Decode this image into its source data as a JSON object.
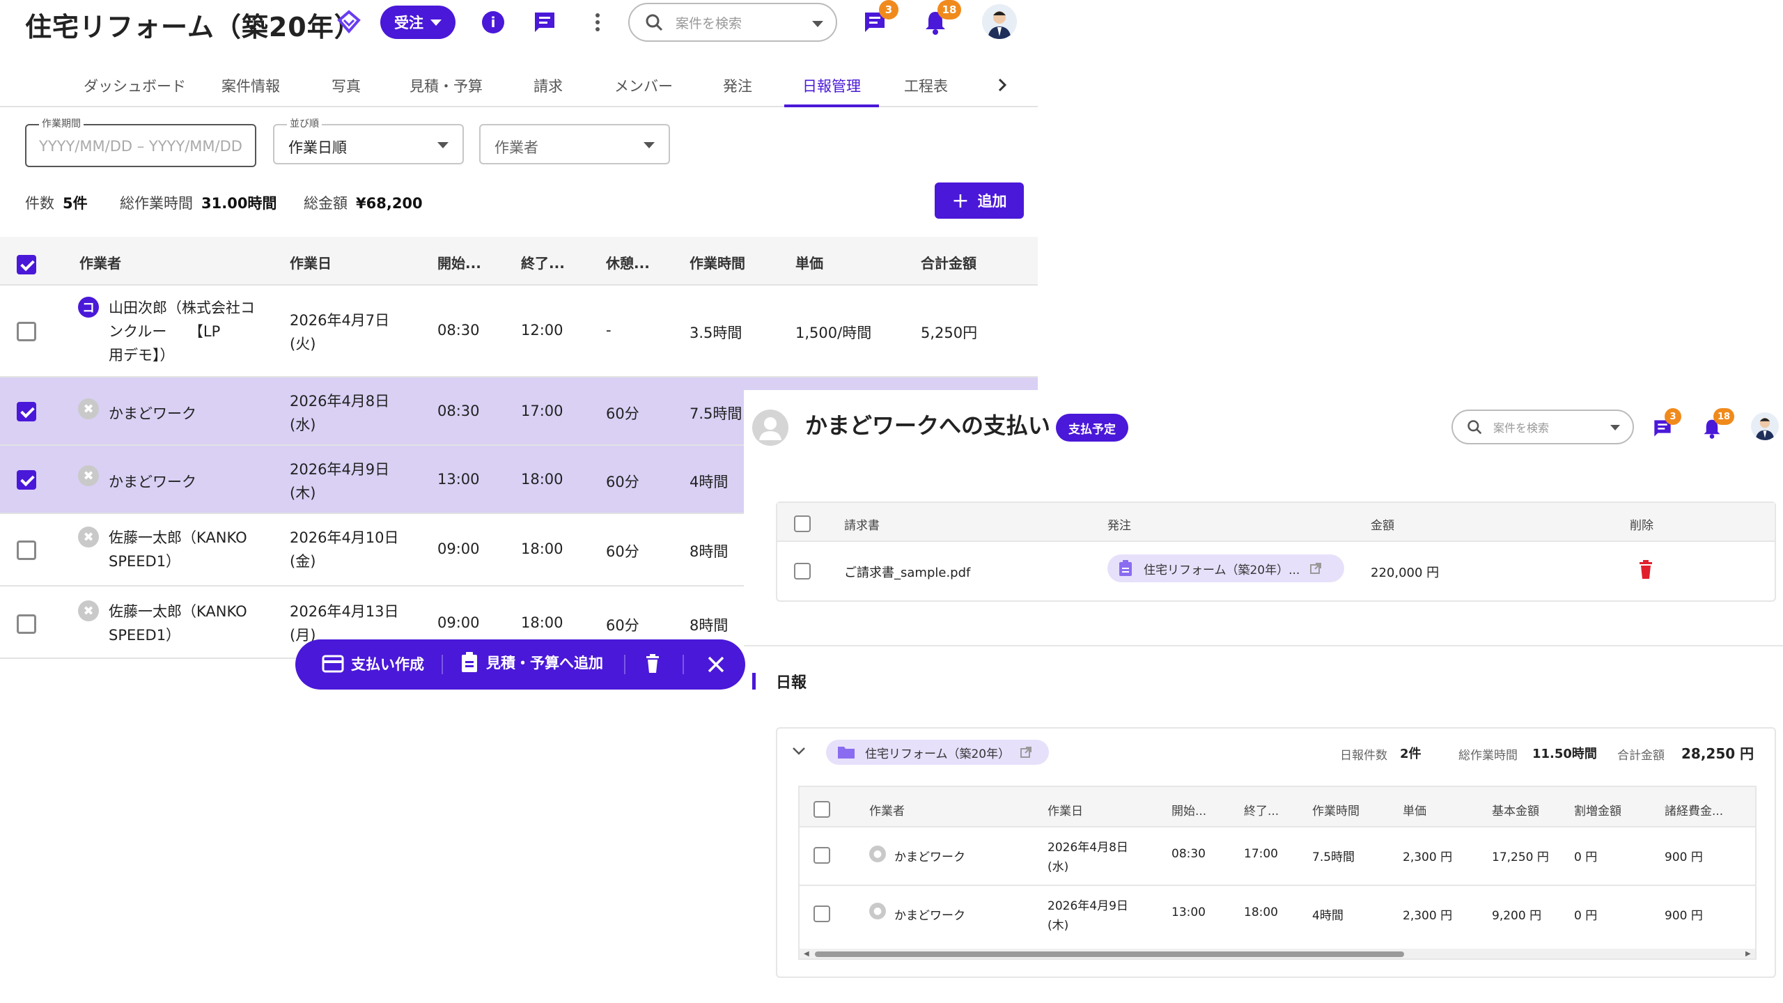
{
  "project": {
    "title": "住宅リフォーム（築20年）",
    "status_label": "受注",
    "search_placeholder": "案件を検索",
    "messages_count": "3",
    "notifications_count": "18"
  },
  "tabs": [
    "ダッシュボード",
    "案件情報",
    "写真",
    "見積・予算",
    "請求",
    "メンバー",
    "発注",
    "日報管理",
    "工程表"
  ],
  "active_tab": "日報管理",
  "filters": {
    "period_label": "作業期間",
    "period_placeholder": "YYYY/MM/DD – YYYY/MM/DD",
    "sort_label": "並び順",
    "sort_value": "作業日順",
    "worker_placeholder": "作業者"
  },
  "summary": {
    "count_label": "件数",
    "count_value": "5件",
    "hours_label": "総作業時間",
    "hours_value": "31.00時間",
    "amount_label": "総金額",
    "amount_value": "¥68,200"
  },
  "add_button": "追加",
  "table": {
    "headers": [
      "作業者",
      "作業日",
      "開始...",
      "終了...",
      "休憩...",
      "作業時間",
      "単価",
      "合計金額"
    ],
    "rows": [
      {
        "worker_line1": "山田次郎（株式会社コ",
        "worker_line2": "ンクルー　　【LP",
        "worker_line3": "用デモ】）",
        "date1": "2026年4月7日",
        "date2": "(火)",
        "start": "08:30",
        "end": "12:00",
        "rest": "-",
        "hours": "3.5時間",
        "rate": "1,500/時間",
        "total": "5,250円",
        "avatar": "コ",
        "selected": false
      },
      {
        "worker_line1": "かまどワーク",
        "worker_line2": "",
        "worker_line3": "",
        "date1": "2026年4月8日",
        "date2": "(水)",
        "start": "08:30",
        "end": "17:00",
        "rest": "60分",
        "hours": "7.5時間",
        "rate": "",
        "total": "",
        "selected": true
      },
      {
        "worker_line1": "かまどワーク",
        "worker_line2": "",
        "worker_line3": "",
        "date1": "2026年4月9日",
        "date2": "(木)",
        "start": "13:00",
        "end": "18:00",
        "rest": "60分",
        "hours": "4時間",
        "rate": "",
        "total": "",
        "selected": true
      },
      {
        "worker_line1": "佐藤一太郎（KANKO",
        "worker_line2": "SPEED1）",
        "worker_line3": "",
        "date1": "2026年4月10日",
        "date2": "(金)",
        "start": "09:00",
        "end": "18:00",
        "rest": "60分",
        "hours": "8時間",
        "rate": "",
        "total": "",
        "selected": false
      },
      {
        "worker_line1": "佐藤一太郎（KANKO",
        "worker_line2": "SPEED1）",
        "worker_line3": "",
        "date1": "2026年4月13日",
        "date2": "(月)",
        "start": "09:00",
        "end": "18:00",
        "rest": "60分",
        "hours": "8時間",
        "rate": "",
        "total": "",
        "selected": false
      }
    ]
  },
  "bulk_bar": {
    "create_payment": "支払い作成",
    "add_to_estimate": "見積・予算へ追加"
  },
  "payment": {
    "title": "かまどワークへの支払い",
    "status": "支払予定",
    "search_placeholder": "案件を検索",
    "messages_count": "3",
    "notifications_count": "18",
    "invoice_headers": [
      "請求書",
      "発注",
      "金額",
      "削除"
    ],
    "invoice_file": "ご請求書_sample.pdf",
    "invoice_order": "住宅リフォーム（築20年）...",
    "invoice_amount": "220,000 円",
    "daily_section": "日報",
    "group_name": "住宅リフォーム（築20年）",
    "group_count_label": "日報件数",
    "group_count": "2件",
    "group_hours_label": "総作業時間",
    "group_hours": "11.50時間",
    "group_total_label": "合計金額",
    "group_total": "28,250 円",
    "daily_headers": [
      "作業者",
      "作業日",
      "開始...",
      "終了...",
      "作業時間",
      "単価",
      "基本金額",
      "割増金額",
      "諸経費金..."
    ],
    "daily_rows": [
      {
        "worker": "かまどワーク",
        "date1": "2026年4月8日",
        "date2": "(水)",
        "start": "08:30",
        "end": "17:00",
        "hours": "7.5時間",
        "rate": "2,300 円",
        "base": "17,250 円",
        "extra": "0 円",
        "misc": "900 円"
      },
      {
        "worker": "かまどワーク",
        "date1": "2026年4月9日",
        "date2": "(木)",
        "start": "13:00",
        "end": "18:00",
        "hours": "4時間",
        "rate": "2,300 円",
        "base": "9,200 円",
        "extra": "0 円",
        "misc": "900 円"
      }
    ]
  },
  "colors": {
    "accent": "#4a18d8",
    "selected_row": "#d9d0f4",
    "badge": "#f08a1c",
    "delete": "#e0202c",
    "chip": "#e7e0fb"
  }
}
